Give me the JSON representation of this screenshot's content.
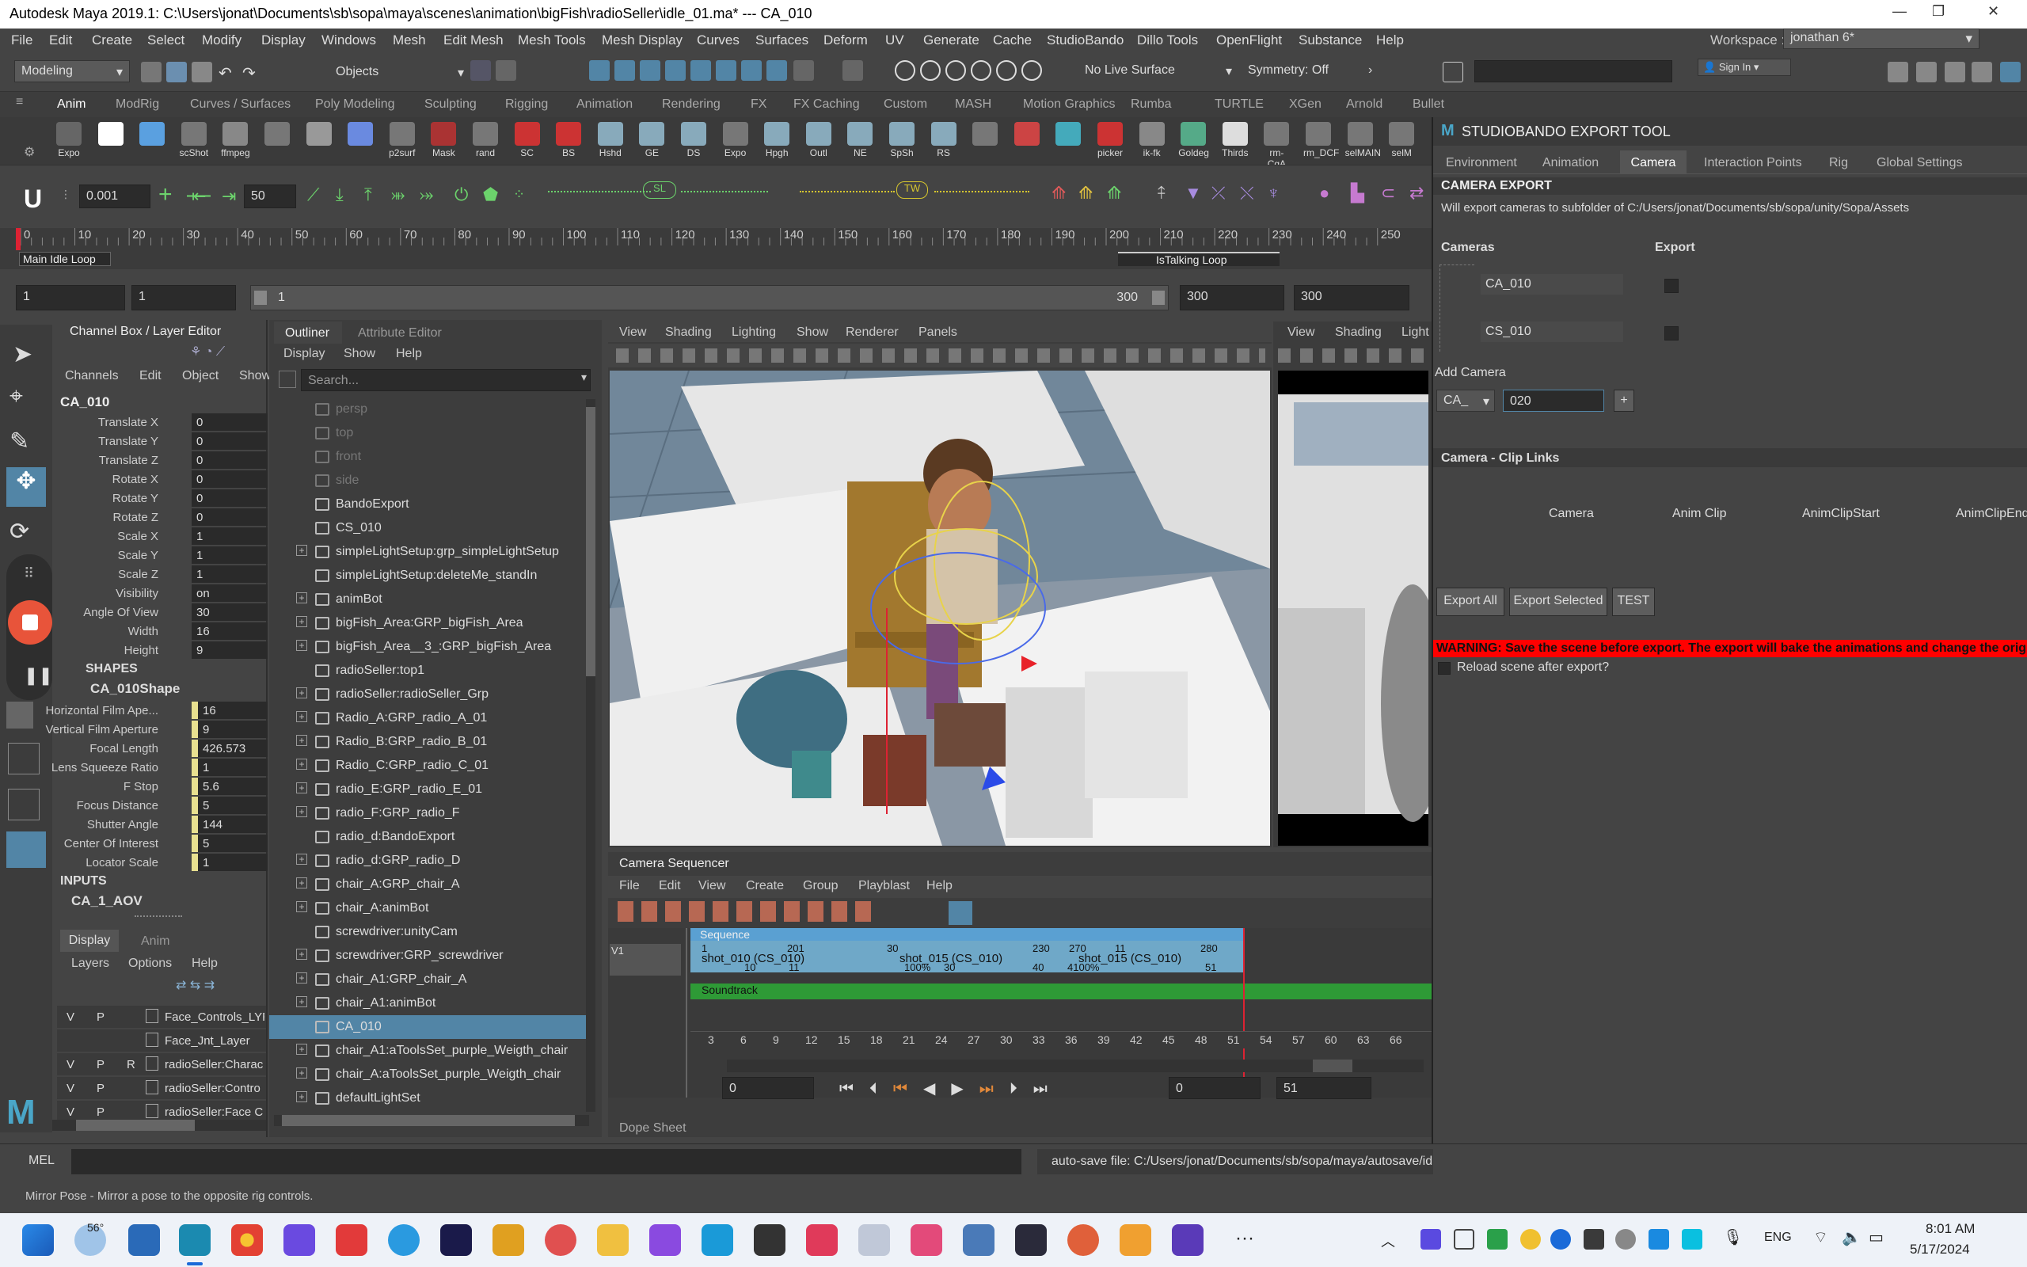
{
  "title_bar": {
    "text": "Autodesk Maya 2019.1: C:\\Users\\jonat\\Documents\\sb\\sopa\\maya\\scenes\\animation\\bigFish\\radioSeller\\idle_01.ma*   ---   CA_010"
  },
  "menu": [
    "File",
    "Edit",
    "Create",
    "Select",
    "Modify",
    "Display",
    "Windows",
    "Mesh",
    "Edit Mesh",
    "Mesh Tools",
    "Mesh Display",
    "Curves",
    "Surfaces",
    "Deform",
    "UV",
    "Generate",
    "Cache",
    "StudioBando",
    "Dillo Tools",
    "OpenFlight",
    "Substance",
    "Help"
  ],
  "workspace": {
    "label": "Workspace :",
    "value": "jonathan 6*"
  },
  "status": {
    "menuset": "Modeling",
    "objects": "Objects",
    "live": "No Live Surface",
    "symmetry": "Symmetry: Off",
    "signin": "Sign In"
  },
  "shelf_tabs": [
    "Anim",
    "ModRig",
    "Curves / Surfaces",
    "Poly Modeling",
    "Sculpting",
    "Rigging",
    "Animation",
    "Rendering",
    "FX",
    "FX Caching",
    "Custom",
    "MASH",
    "Motion Graphics",
    "Rumba",
    "TURTLE",
    "XGen",
    "Arnold",
    "Bullet"
  ],
  "shelf_buttons": [
    "Expo",
    "",
    "",
    "scShot",
    "ffmpeg",
    "",
    "",
    "",
    "p2surf",
    "Mask",
    "rand",
    "SC",
    "BS",
    "Hshd",
    "GE",
    "DS",
    "Expo",
    "Hpgh",
    "Outl",
    "NE",
    "SpSh",
    "RS",
    "",
    "",
    "",
    "picker",
    "ik-fk",
    "Goldeg",
    "Thirds",
    "rm-CgA",
    "rm_DCF",
    "selMAIN",
    "selM"
  ],
  "anim_tools": {
    "step": "0.001",
    "frames": "50",
    "sl": "SL",
    "tw": "TW"
  },
  "timeline": {
    "ticks": [
      "0",
      "10",
      "20",
      "30",
      "40",
      "50",
      "60",
      "70",
      "80",
      "90",
      "100",
      "110",
      "120",
      "130",
      "140",
      "150",
      "160",
      "170",
      "180",
      "190",
      "200",
      "210",
      "220",
      "230",
      "240",
      "250"
    ],
    "marker1": "Main Idle Loop",
    "marker2": "IsTalking Loop"
  },
  "range": {
    "start": "1",
    "start2": "1",
    "slider_start": "1",
    "slider_end": "300",
    "end1": "300",
    "end2": "300"
  },
  "channel_box": {
    "header": "Channel Box / Layer Editor",
    "menus": [
      "Channels",
      "Edit",
      "Object",
      "Show"
    ],
    "object": "CA_010",
    "transform": [
      [
        "Translate X",
        "0"
      ],
      [
        "Translate Y",
        "0"
      ],
      [
        "Translate Z",
        "0"
      ],
      [
        "Rotate X",
        "0"
      ],
      [
        "Rotate Y",
        "0"
      ],
      [
        "Rotate Z",
        "0"
      ],
      [
        "Scale X",
        "1"
      ],
      [
        "Scale Y",
        "1"
      ],
      [
        "Scale Z",
        "1"
      ],
      [
        "Visibility",
        "on"
      ],
      [
        "Angle Of View",
        "30"
      ],
      [
        "Width",
        "16"
      ],
      [
        "Height",
        "9"
      ]
    ],
    "shapes_label": "SHAPES",
    "shape_name": "CA_010Shape",
    "shape": [
      [
        "Horizontal Film Ape...",
        "16"
      ],
      [
        "Vertical Film Aperture",
        "9"
      ],
      [
        "Focal Length",
        "426.573"
      ],
      [
        "Lens Squeeze Ratio",
        "1"
      ],
      [
        "F Stop",
        "5.6"
      ],
      [
        "Focus Distance",
        "5"
      ],
      [
        "Shutter Angle",
        "144"
      ],
      [
        "Center Of Interest",
        "5"
      ],
      [
        "Locator Scale",
        "1"
      ]
    ],
    "inputs_label": "INPUTS",
    "input_name": "CA_1_AOV",
    "layer_tabs": [
      "Display",
      "Anim"
    ],
    "layer_menus": [
      "Layers",
      "Options",
      "Help"
    ],
    "layers": [
      [
        "V",
        "P",
        "",
        "Face_Controls_LYR"
      ],
      [
        "",
        "",
        "",
        "Face_Jnt_Layer"
      ],
      [
        "V",
        "P",
        "R",
        "radioSeller:Charac"
      ],
      [
        "V",
        "P",
        "",
        "radioSeller:Contro"
      ],
      [
        "V",
        "P",
        "",
        "radioSeller:Face C"
      ]
    ]
  },
  "outliner": {
    "tabs": [
      "Outliner",
      "Attribute Editor"
    ],
    "menus": [
      "Display",
      "Show",
      "Help"
    ],
    "search_placeholder": "Search...",
    "items": [
      {
        "name": "persp",
        "dim": true,
        "exp": false
      },
      {
        "name": "top",
        "dim": true,
        "exp": false
      },
      {
        "name": "front",
        "dim": true,
        "exp": false
      },
      {
        "name": "side",
        "dim": true,
        "exp": false
      },
      {
        "name": "BandoExport",
        "dim": false,
        "exp": false
      },
      {
        "name": "CS_010",
        "dim": false,
        "exp": false
      },
      {
        "name": "simpleLightSetup:grp_simpleLightSetup",
        "dim": false,
        "exp": true
      },
      {
        "name": "simpleLightSetup:deleteMe_standIn",
        "dim": false,
        "exp": false
      },
      {
        "name": "animBot",
        "dim": false,
        "exp": true
      },
      {
        "name": "bigFish_Area:GRP_bigFish_Area",
        "dim": false,
        "exp": true
      },
      {
        "name": "bigFish_Area__3_:GRP_bigFish_Area",
        "dim": false,
        "exp": true
      },
      {
        "name": "radioSeller:top1",
        "dim": false,
        "exp": false
      },
      {
        "name": "radioSeller:radioSeller_Grp",
        "dim": false,
        "exp": true
      },
      {
        "name": "Radio_A:GRP_radio_A_01",
        "dim": false,
        "exp": true
      },
      {
        "name": "Radio_B:GRP_radio_B_01",
        "dim": false,
        "exp": true
      },
      {
        "name": "Radio_C:GRP_radio_C_01",
        "dim": false,
        "exp": true
      },
      {
        "name": "radio_E:GRP_radio_E_01",
        "dim": false,
        "exp": true
      },
      {
        "name": "radio_F:GRP_radio_F",
        "dim": false,
        "exp": true
      },
      {
        "name": "radio_d:BandoExport",
        "dim": false,
        "exp": false
      },
      {
        "name": "radio_d:GRP_radio_D",
        "dim": false,
        "exp": true
      },
      {
        "name": "chair_A:GRP_chair_A",
        "dim": false,
        "exp": true
      },
      {
        "name": "chair_A:animBot",
        "dim": false,
        "exp": true
      },
      {
        "name": "screwdriver:unityCam",
        "dim": false,
        "exp": false
      },
      {
        "name": "screwdriver:GRP_screwdriver",
        "dim": false,
        "exp": true
      },
      {
        "name": "chair_A1:GRP_chair_A",
        "dim": false,
        "exp": true
      },
      {
        "name": "chair_A1:animBot",
        "dim": false,
        "exp": true
      },
      {
        "name": "CA_010",
        "dim": false,
        "exp": false,
        "sel": true
      },
      {
        "name": "chair_A1:aToolsSet_purple_Weigth_chair",
        "dim": false,
        "exp": true
      },
      {
        "name": "chair_A:aToolsSet_purple_Weigth_chair",
        "dim": false,
        "exp": true
      },
      {
        "name": "defaultLightSet",
        "dim": false,
        "exp": true
      }
    ]
  },
  "viewport": {
    "menus": [
      "View",
      "Shading",
      "Lighting",
      "Show",
      "Renderer",
      "Panels"
    ]
  },
  "view2": {
    "menus": [
      "View",
      "Shading",
      "Light"
    ]
  },
  "camera_sequencer": {
    "title": "Camera Sequencer",
    "menus": [
      "File",
      "Edit",
      "View",
      "Create",
      "Group",
      "Playblast",
      "Help"
    ],
    "sequence": "Sequence",
    "v1": "V1",
    "shot1": {
      "label": "shot_010 (CS_010)",
      "start": "1",
      "end": "201",
      "s2": "10",
      "e2": "11"
    },
    "shot2": {
      "label": "shot_015 (CS_010)",
      "pct": "100%",
      "s": "30",
      "e": "230",
      "s2": "30",
      "e2": "40"
    },
    "shot3": {
      "label": "shot_015 (CS_010)",
      "pct": "4100%",
      "s": "270",
      "e": "280",
      "a": "11",
      "b": "51"
    },
    "soundtrack": "Soundtrack",
    "ruler": [
      "3",
      "6",
      "9",
      "12",
      "15",
      "18",
      "21",
      "24",
      "27",
      "30",
      "33",
      "36",
      "39",
      "42",
      "45",
      "48",
      "51",
      "54",
      "57",
      "60",
      "63",
      "66"
    ],
    "play_start": "0",
    "play_end": "0",
    "play_end2": "51",
    "dope": "Dope Sheet"
  },
  "export_tool": {
    "title": "STUDIOBANDO EXPORT TOOL",
    "tabs": [
      "Environment",
      "Animation",
      "Camera",
      "Interaction Points",
      "Rig",
      "Global Settings"
    ],
    "section": "CAMERA EXPORT",
    "desc": "Will export cameras to subfolder of C:/Users/jonat/Documents/sb/sopa/unity/Sopa/Assets",
    "col_cameras": "Cameras",
    "col_export": "Export",
    "cameras": [
      "CA_010",
      "CS_010"
    ],
    "add_camera": "Add Camera",
    "prefix": "CA_",
    "number": "020",
    "plus": "+",
    "clip_links": "Camera - Clip Links",
    "clip_cols": [
      "Camera",
      "Anim Clip",
      "AnimClipStart",
      "AnimClipEnd"
    ],
    "buttons": [
      "Export All",
      "Export Selected",
      "TEST"
    ],
    "warning": "WARNING: Save the scene before export. The export will bake the animations and change the original",
    "reload": "Reload scene after export?"
  },
  "cmd": {
    "label": "MEL",
    "autosave": "auto-save file: C:/Users/jonat/Documents/sb/sopa/maya/autosave/id"
  },
  "help": "Mirror Pose - Mirror a pose to the opposite rig controls.",
  "taskbar": {
    "weather": "56°",
    "lang": "ENG",
    "time": "8:01 AM",
    "date": "5/17/2024"
  },
  "colors": {
    "accent": "#5285a6",
    "selected": "#5285a6",
    "warning": "#ff0000",
    "soundtrack": "#2e9a36",
    "shot": "#6fa8c8"
  }
}
